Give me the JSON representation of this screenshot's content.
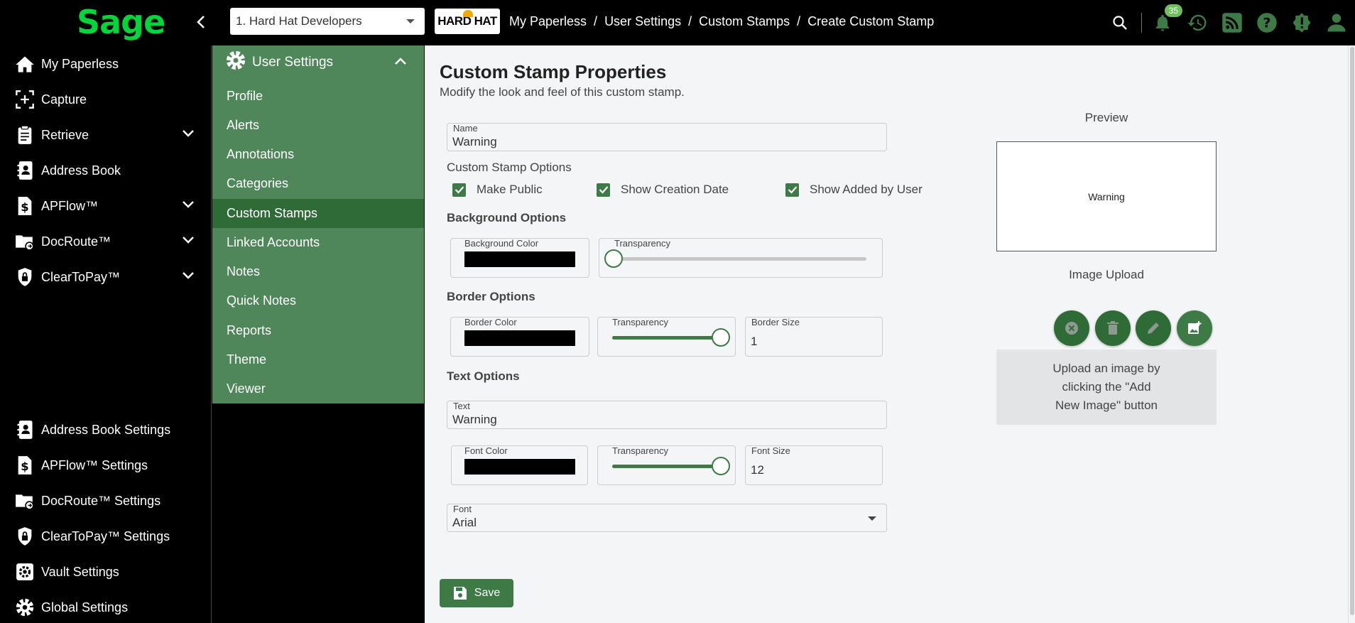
{
  "app": {
    "logo_text": "Sage"
  },
  "header": {
    "company": "1. Hard Hat Developers",
    "company_logo_text": "HARD HAT",
    "breadcrumb": [
      "My Paperless",
      "User Settings",
      "Custom Stamps",
      "Create Custom Stamp"
    ],
    "notification_count": "35",
    "icons": [
      "search-icon",
      "bell-icon",
      "history-icon",
      "rss-icon",
      "help-icon",
      "alert-icon",
      "user-icon"
    ]
  },
  "leftnav": {
    "top_items": [
      {
        "label": "My Paperless",
        "icon": "home-icon"
      },
      {
        "label": "Capture",
        "icon": "capture-icon"
      },
      {
        "label": "Retrieve",
        "icon": "clipboard-icon",
        "expandable": true
      },
      {
        "label": "Address Book",
        "icon": "contact-icon"
      },
      {
        "label": "APFlow™",
        "icon": "dollar-icon",
        "expandable": true
      },
      {
        "label": "DocRoute™",
        "icon": "folder-route-icon",
        "expandable": true
      },
      {
        "label": "ClearToPay™",
        "icon": "shield-lock-icon",
        "expandable": true
      }
    ],
    "bottom_items": [
      {
        "label": "Address Book Settings",
        "icon": "contact-icon"
      },
      {
        "label": "APFlow™ Settings",
        "icon": "dollar-icon"
      },
      {
        "label": "DocRoute™ Settings",
        "icon": "folder-route-icon"
      },
      {
        "label": "ClearToPay™ Settings",
        "icon": "shield-lock-icon"
      },
      {
        "label": "Vault Settings",
        "icon": "gear-box-icon"
      },
      {
        "label": "Global Settings",
        "icon": "gear-icon"
      }
    ]
  },
  "submenu": {
    "title": "User Settings",
    "items": [
      "Profile",
      "Alerts",
      "Annotations",
      "Categories",
      "Custom Stamps",
      "Linked Accounts",
      "Notes",
      "Quick Notes",
      "Reports",
      "Theme",
      "Viewer"
    ],
    "active": "Custom Stamps"
  },
  "main": {
    "title": "Custom Stamp Properties",
    "subtitle": "Modify the look and feel of this custom stamp.",
    "name_label": "Name",
    "name_value": "Warning",
    "options_title": "Custom Stamp Options",
    "checkboxes": [
      {
        "label": "Make Public",
        "checked": true
      },
      {
        "label": "Show Creation Date",
        "checked": true
      },
      {
        "label": "Show Added by User",
        "checked": true
      }
    ],
    "background": {
      "title": "Background Options",
      "color_label": "Background Color",
      "color": "#000000",
      "transparency_label": "Transparency",
      "transparency": 0
    },
    "border": {
      "title": "Border Options",
      "color_label": "Border Color",
      "color": "#000000",
      "transparency_label": "Transparency",
      "transparency": 100,
      "size_label": "Border Size",
      "size": "1"
    },
    "text": {
      "title": "Text Options",
      "text_label": "Text",
      "text_value": "Warning",
      "color_label": "Font Color",
      "color": "#000000",
      "transparency_label": "Transparency",
      "transparency": 100,
      "size_label": "Font Size",
      "size": "12",
      "font_label": "Font",
      "font_value": "Arial"
    },
    "save_label": "Save",
    "preview_label": "Preview",
    "preview_text": "Warning",
    "upload_label": "Image Upload",
    "upload_hint": "Upload an image by clicking the \"Add New Image\" button"
  },
  "colors": {
    "brand": "#00d639",
    "submenu_bg": "#4f865a",
    "submenu_active": "#2f6b37",
    "accent": "#3d7a45"
  }
}
